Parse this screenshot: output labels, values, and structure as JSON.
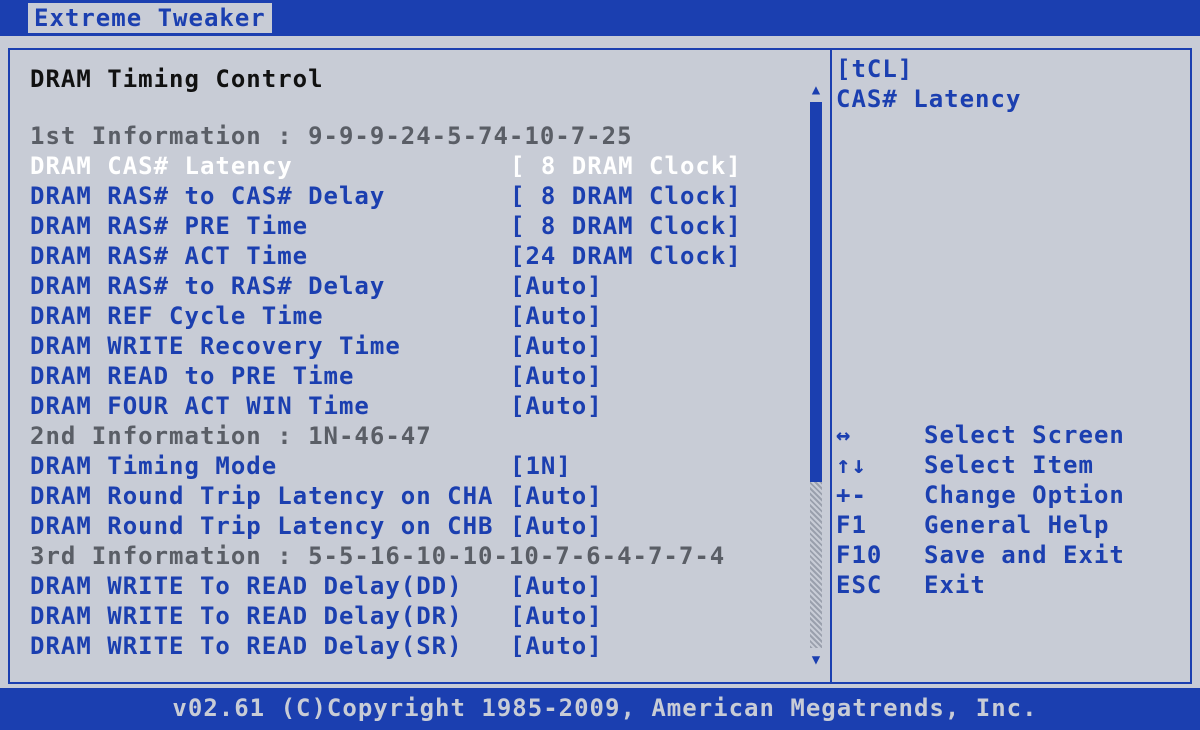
{
  "header": {
    "tab": "Extreme Tweaker"
  },
  "main": {
    "title": "DRAM Timing Control",
    "rows": [
      {
        "type": "info",
        "label": "1st Information : 9-9-9-24-5-74-10-7-25"
      },
      {
        "type": "item",
        "label": "DRAM CAS# Latency",
        "value": "[ 8 DRAM Clock]",
        "selected": true
      },
      {
        "type": "item",
        "label": "DRAM RAS# to CAS# Delay",
        "value": "[ 8 DRAM Clock]"
      },
      {
        "type": "item",
        "label": "DRAM RAS# PRE Time",
        "value": "[ 8 DRAM Clock]"
      },
      {
        "type": "item",
        "label": "DRAM RAS# ACT Time",
        "value": "[24 DRAM Clock]"
      },
      {
        "type": "item",
        "label": "DRAM RAS# to RAS# Delay",
        "value": "[Auto]"
      },
      {
        "type": "item",
        "label": "DRAM REF Cycle Time",
        "value": "[Auto]"
      },
      {
        "type": "item",
        "label": "DRAM WRITE Recovery Time",
        "value": "[Auto]"
      },
      {
        "type": "item",
        "label": "DRAM READ to PRE Time",
        "value": "[Auto]"
      },
      {
        "type": "item",
        "label": "DRAM FOUR ACT WIN Time",
        "value": "[Auto]"
      },
      {
        "type": "info",
        "label": "2nd Information : 1N-46-47"
      },
      {
        "type": "item",
        "label": "DRAM Timing Mode",
        "value": "[1N]"
      },
      {
        "type": "item",
        "label": "DRAM Round Trip Latency on CHA",
        "value": "[Auto]"
      },
      {
        "type": "item",
        "label": "DRAM Round Trip Latency on CHB",
        "value": "[Auto]"
      },
      {
        "type": "info",
        "label": "3rd Information : 5-5-16-10-10-10-7-6-4-7-7-4"
      },
      {
        "type": "item",
        "label": "DRAM WRITE To READ Delay(DD)",
        "value": "[Auto]"
      },
      {
        "type": "item",
        "label": "DRAM WRITE To READ Delay(DR)",
        "value": "[Auto]"
      },
      {
        "type": "item",
        "label": "DRAM WRITE To READ Delay(SR)",
        "value": "[Auto]"
      }
    ]
  },
  "help": {
    "key": "[tCL]",
    "description": "CAS# Latency"
  },
  "keys": [
    {
      "key": "↔",
      "action": "Select Screen"
    },
    {
      "key": "↑↓",
      "action": "Select Item"
    },
    {
      "key": "+-",
      "action": "Change Option"
    },
    {
      "key": "F1",
      "action": "General Help"
    },
    {
      "key": "F10",
      "action": "Save and Exit"
    },
    {
      "key": "ESC",
      "action": "Exit"
    }
  ],
  "footer": {
    "text": "v02.61 (C)Copyright 1985-2009, American Megatrends, Inc."
  },
  "colors": {
    "blue": "#1b3fb0",
    "gray": "#c8ccd6",
    "white": "#ffffff"
  }
}
